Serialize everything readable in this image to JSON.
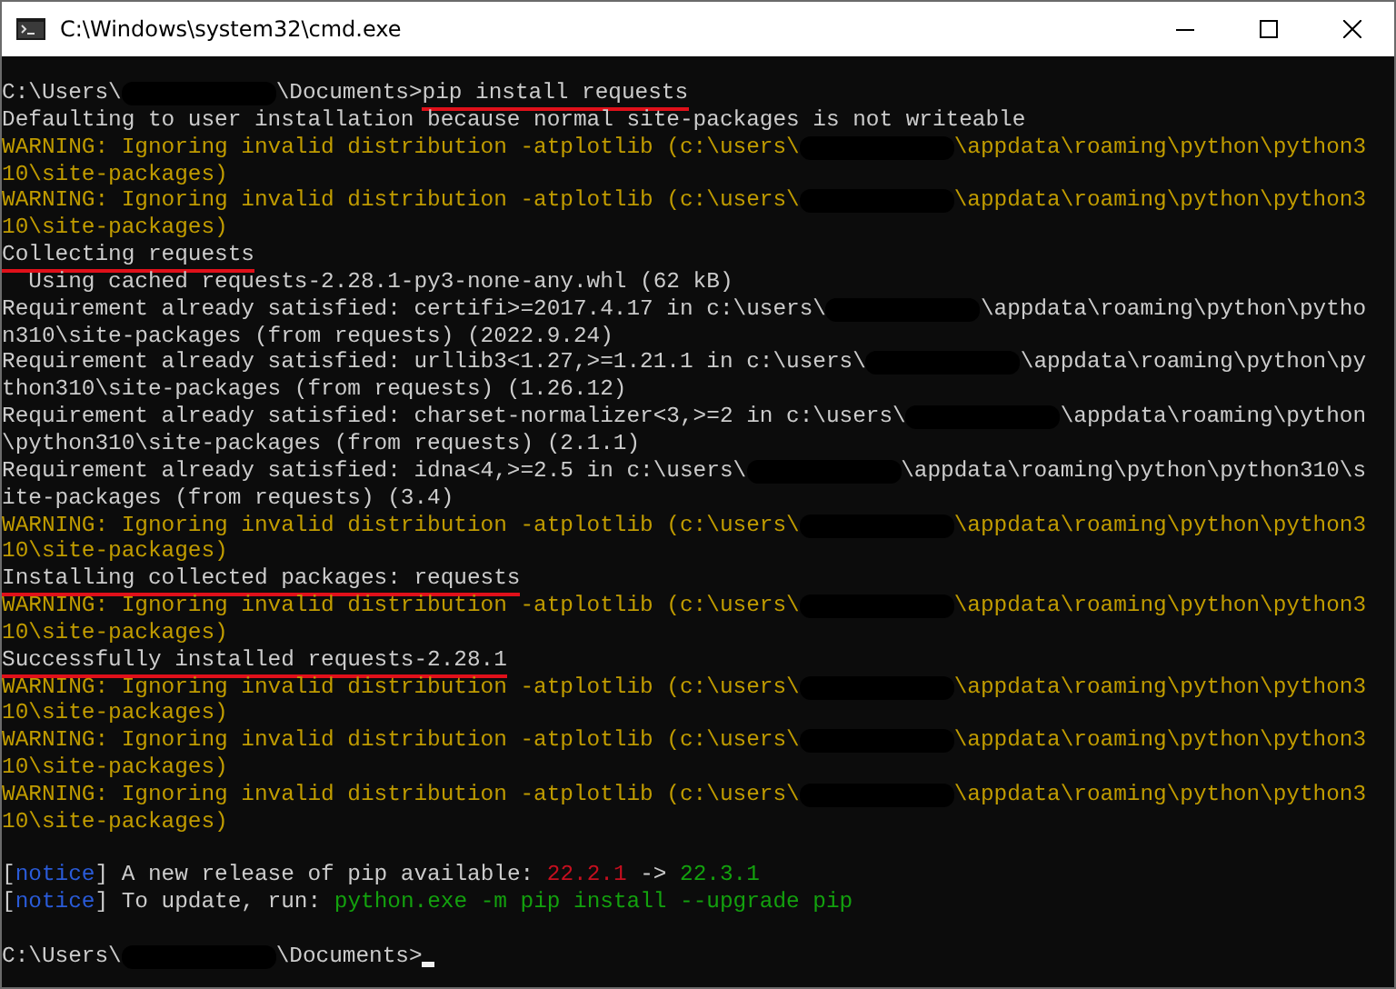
{
  "window": {
    "title": "C:\\Windows\\system32\\cmd.exe"
  },
  "lines": [
    {
      "segments": [
        {
          "kind": "text",
          "text": "C:\\Users\\",
          "color": "#cccccc"
        },
        {
          "kind": "redaction"
        },
        {
          "kind": "text",
          "text": "\\Documents>",
          "color": "#cccccc"
        },
        {
          "kind": "text",
          "text": "pip install requests",
          "color": "#cccccc",
          "underlined": true
        }
      ]
    },
    {
      "segments": [
        {
          "kind": "text",
          "text": "Defaulting to user installation because normal site-packages is not writeable",
          "color": "#cccccc"
        }
      ]
    },
    {
      "segments": [
        {
          "kind": "text",
          "text": "WARNING: Ignoring invalid distribution -atplotlib (c:\\users\\",
          "color": "#c19c00"
        },
        {
          "kind": "redaction"
        },
        {
          "kind": "text",
          "text": "\\appdata\\roaming\\python\\python3",
          "color": "#c19c00"
        }
      ]
    },
    {
      "segments": [
        {
          "kind": "text",
          "text": "10\\site-packages)",
          "color": "#c19c00"
        }
      ]
    },
    {
      "segments": [
        {
          "kind": "text",
          "text": "WARNING: Ignoring invalid distribution -atplotlib (c:\\users\\",
          "color": "#c19c00"
        },
        {
          "kind": "redaction"
        },
        {
          "kind": "text",
          "text": "\\appdata\\roaming\\python\\python3",
          "color": "#c19c00"
        }
      ]
    },
    {
      "segments": [
        {
          "kind": "text",
          "text": "10\\site-packages)",
          "color": "#c19c00"
        }
      ]
    },
    {
      "segments": [
        {
          "kind": "text",
          "text": "Collecting requests",
          "color": "#cccccc",
          "underlined": true
        }
      ]
    },
    {
      "segments": [
        {
          "kind": "text",
          "text": "  Using cached requests-2.28.1-py3-none-any.whl (62 kB)",
          "color": "#cccccc"
        }
      ]
    },
    {
      "segments": [
        {
          "kind": "text",
          "text": "Requirement already satisfied: certifi>=2017.4.17 in c:\\users\\",
          "color": "#cccccc"
        },
        {
          "kind": "redaction"
        },
        {
          "kind": "text",
          "text": "\\appdata\\roaming\\python\\pytho",
          "color": "#cccccc"
        }
      ]
    },
    {
      "segments": [
        {
          "kind": "text",
          "text": "n310\\site-packages (from requests) (2022.9.24)",
          "color": "#cccccc"
        }
      ]
    },
    {
      "segments": [
        {
          "kind": "text",
          "text": "Requirement already satisfied: urllib3<1.27,>=1.21.1 in c:\\users\\",
          "color": "#cccccc"
        },
        {
          "kind": "redaction"
        },
        {
          "kind": "text",
          "text": "\\appdata\\roaming\\python\\py",
          "color": "#cccccc"
        }
      ]
    },
    {
      "segments": [
        {
          "kind": "text",
          "text": "thon310\\site-packages (from requests) (1.26.12)",
          "color": "#cccccc"
        }
      ]
    },
    {
      "segments": [
        {
          "kind": "text",
          "text": "Requirement already satisfied: charset-normalizer<3,>=2 in c:\\users\\",
          "color": "#cccccc"
        },
        {
          "kind": "redaction"
        },
        {
          "kind": "text",
          "text": "\\appdata\\roaming\\python",
          "color": "#cccccc"
        }
      ]
    },
    {
      "segments": [
        {
          "kind": "text",
          "text": "\\python310\\site-packages (from requests) (2.1.1)",
          "color": "#cccccc"
        }
      ]
    },
    {
      "segments": [
        {
          "kind": "text",
          "text": "Requirement already satisfied: idna<4,>=2.5 in c:\\users\\",
          "color": "#cccccc"
        },
        {
          "kind": "redaction"
        },
        {
          "kind": "text",
          "text": "\\appdata\\roaming\\python\\python310\\s",
          "color": "#cccccc"
        }
      ]
    },
    {
      "segments": [
        {
          "kind": "text",
          "text": "ite-packages (from requests) (3.4)",
          "color": "#cccccc"
        }
      ]
    },
    {
      "segments": [
        {
          "kind": "text",
          "text": "WARNING: Ignoring invalid distribution -atplotlib (c:\\users\\",
          "color": "#c19c00"
        },
        {
          "kind": "redaction"
        },
        {
          "kind": "text",
          "text": "\\appdata\\roaming\\python\\python3",
          "color": "#c19c00"
        }
      ]
    },
    {
      "segments": [
        {
          "kind": "text",
          "text": "10\\site-packages)",
          "color": "#c19c00"
        }
      ]
    },
    {
      "segments": [
        {
          "kind": "text",
          "text": "Installing collected packages: requests",
          "color": "#cccccc",
          "underlined": true
        }
      ]
    },
    {
      "segments": [
        {
          "kind": "text",
          "text": "WARNING: Ignoring invalid distribution -atplotlib (c:\\users\\",
          "color": "#c19c00"
        },
        {
          "kind": "redaction"
        },
        {
          "kind": "text",
          "text": "\\appdata\\roaming\\python\\python3",
          "color": "#c19c00"
        }
      ]
    },
    {
      "segments": [
        {
          "kind": "text",
          "text": "10\\site-packages)",
          "color": "#c19c00"
        }
      ]
    },
    {
      "segments": [
        {
          "kind": "text",
          "text": "Successfully installed requests-2.28.1",
          "color": "#cccccc",
          "underlined": true
        }
      ]
    },
    {
      "segments": [
        {
          "kind": "text",
          "text": "WARNING: Ignoring invalid distribution -atplotlib (c:\\users\\",
          "color": "#c19c00"
        },
        {
          "kind": "redaction"
        },
        {
          "kind": "text",
          "text": "\\appdata\\roaming\\python\\python3",
          "color": "#c19c00"
        }
      ]
    },
    {
      "segments": [
        {
          "kind": "text",
          "text": "10\\site-packages)",
          "color": "#c19c00"
        }
      ]
    },
    {
      "segments": [
        {
          "kind": "text",
          "text": "WARNING: Ignoring invalid distribution -atplotlib (c:\\users\\",
          "color": "#c19c00"
        },
        {
          "kind": "redaction"
        },
        {
          "kind": "text",
          "text": "\\appdata\\roaming\\python\\python3",
          "color": "#c19c00"
        }
      ]
    },
    {
      "segments": [
        {
          "kind": "text",
          "text": "10\\site-packages)",
          "color": "#c19c00"
        }
      ]
    },
    {
      "segments": [
        {
          "kind": "text",
          "text": "WARNING: Ignoring invalid distribution -atplotlib (c:\\users\\",
          "color": "#c19c00"
        },
        {
          "kind": "redaction"
        },
        {
          "kind": "text",
          "text": "\\appdata\\roaming\\python\\python3",
          "color": "#c19c00"
        }
      ]
    },
    {
      "segments": [
        {
          "kind": "text",
          "text": "10\\site-packages)",
          "color": "#c19c00"
        }
      ]
    },
    {
      "blank_line_before": true,
      "segments": [
        {
          "kind": "text",
          "text": "[",
          "color": "#cccccc"
        },
        {
          "kind": "text",
          "text": "notice",
          "color": "#2a5bd8"
        },
        {
          "kind": "text",
          "text": "] A new release of pip available: ",
          "color": "#cccccc"
        },
        {
          "kind": "text",
          "text": "22.2.1",
          "color": "#c50f1f"
        },
        {
          "kind": "text",
          "text": " -> ",
          "color": "#cccccc"
        },
        {
          "kind": "text",
          "text": "22.3.1",
          "color": "#13a10e"
        }
      ]
    },
    {
      "segments": [
        {
          "kind": "text",
          "text": "[",
          "color": "#cccccc"
        },
        {
          "kind": "text",
          "text": "notice",
          "color": "#2a5bd8"
        },
        {
          "kind": "text",
          "text": "] To update, run: ",
          "color": "#cccccc"
        },
        {
          "kind": "text",
          "text": "python.exe -m pip install --upgrade pip",
          "color": "#13a10e"
        }
      ]
    },
    {
      "blank_line_before": true,
      "segments": [
        {
          "kind": "text",
          "text": "C:\\Users\\",
          "color": "#cccccc"
        },
        {
          "kind": "redaction"
        },
        {
          "kind": "text",
          "text": "\\Documents>",
          "color": "#cccccc"
        },
        {
          "kind": "cursor"
        }
      ]
    }
  ]
}
